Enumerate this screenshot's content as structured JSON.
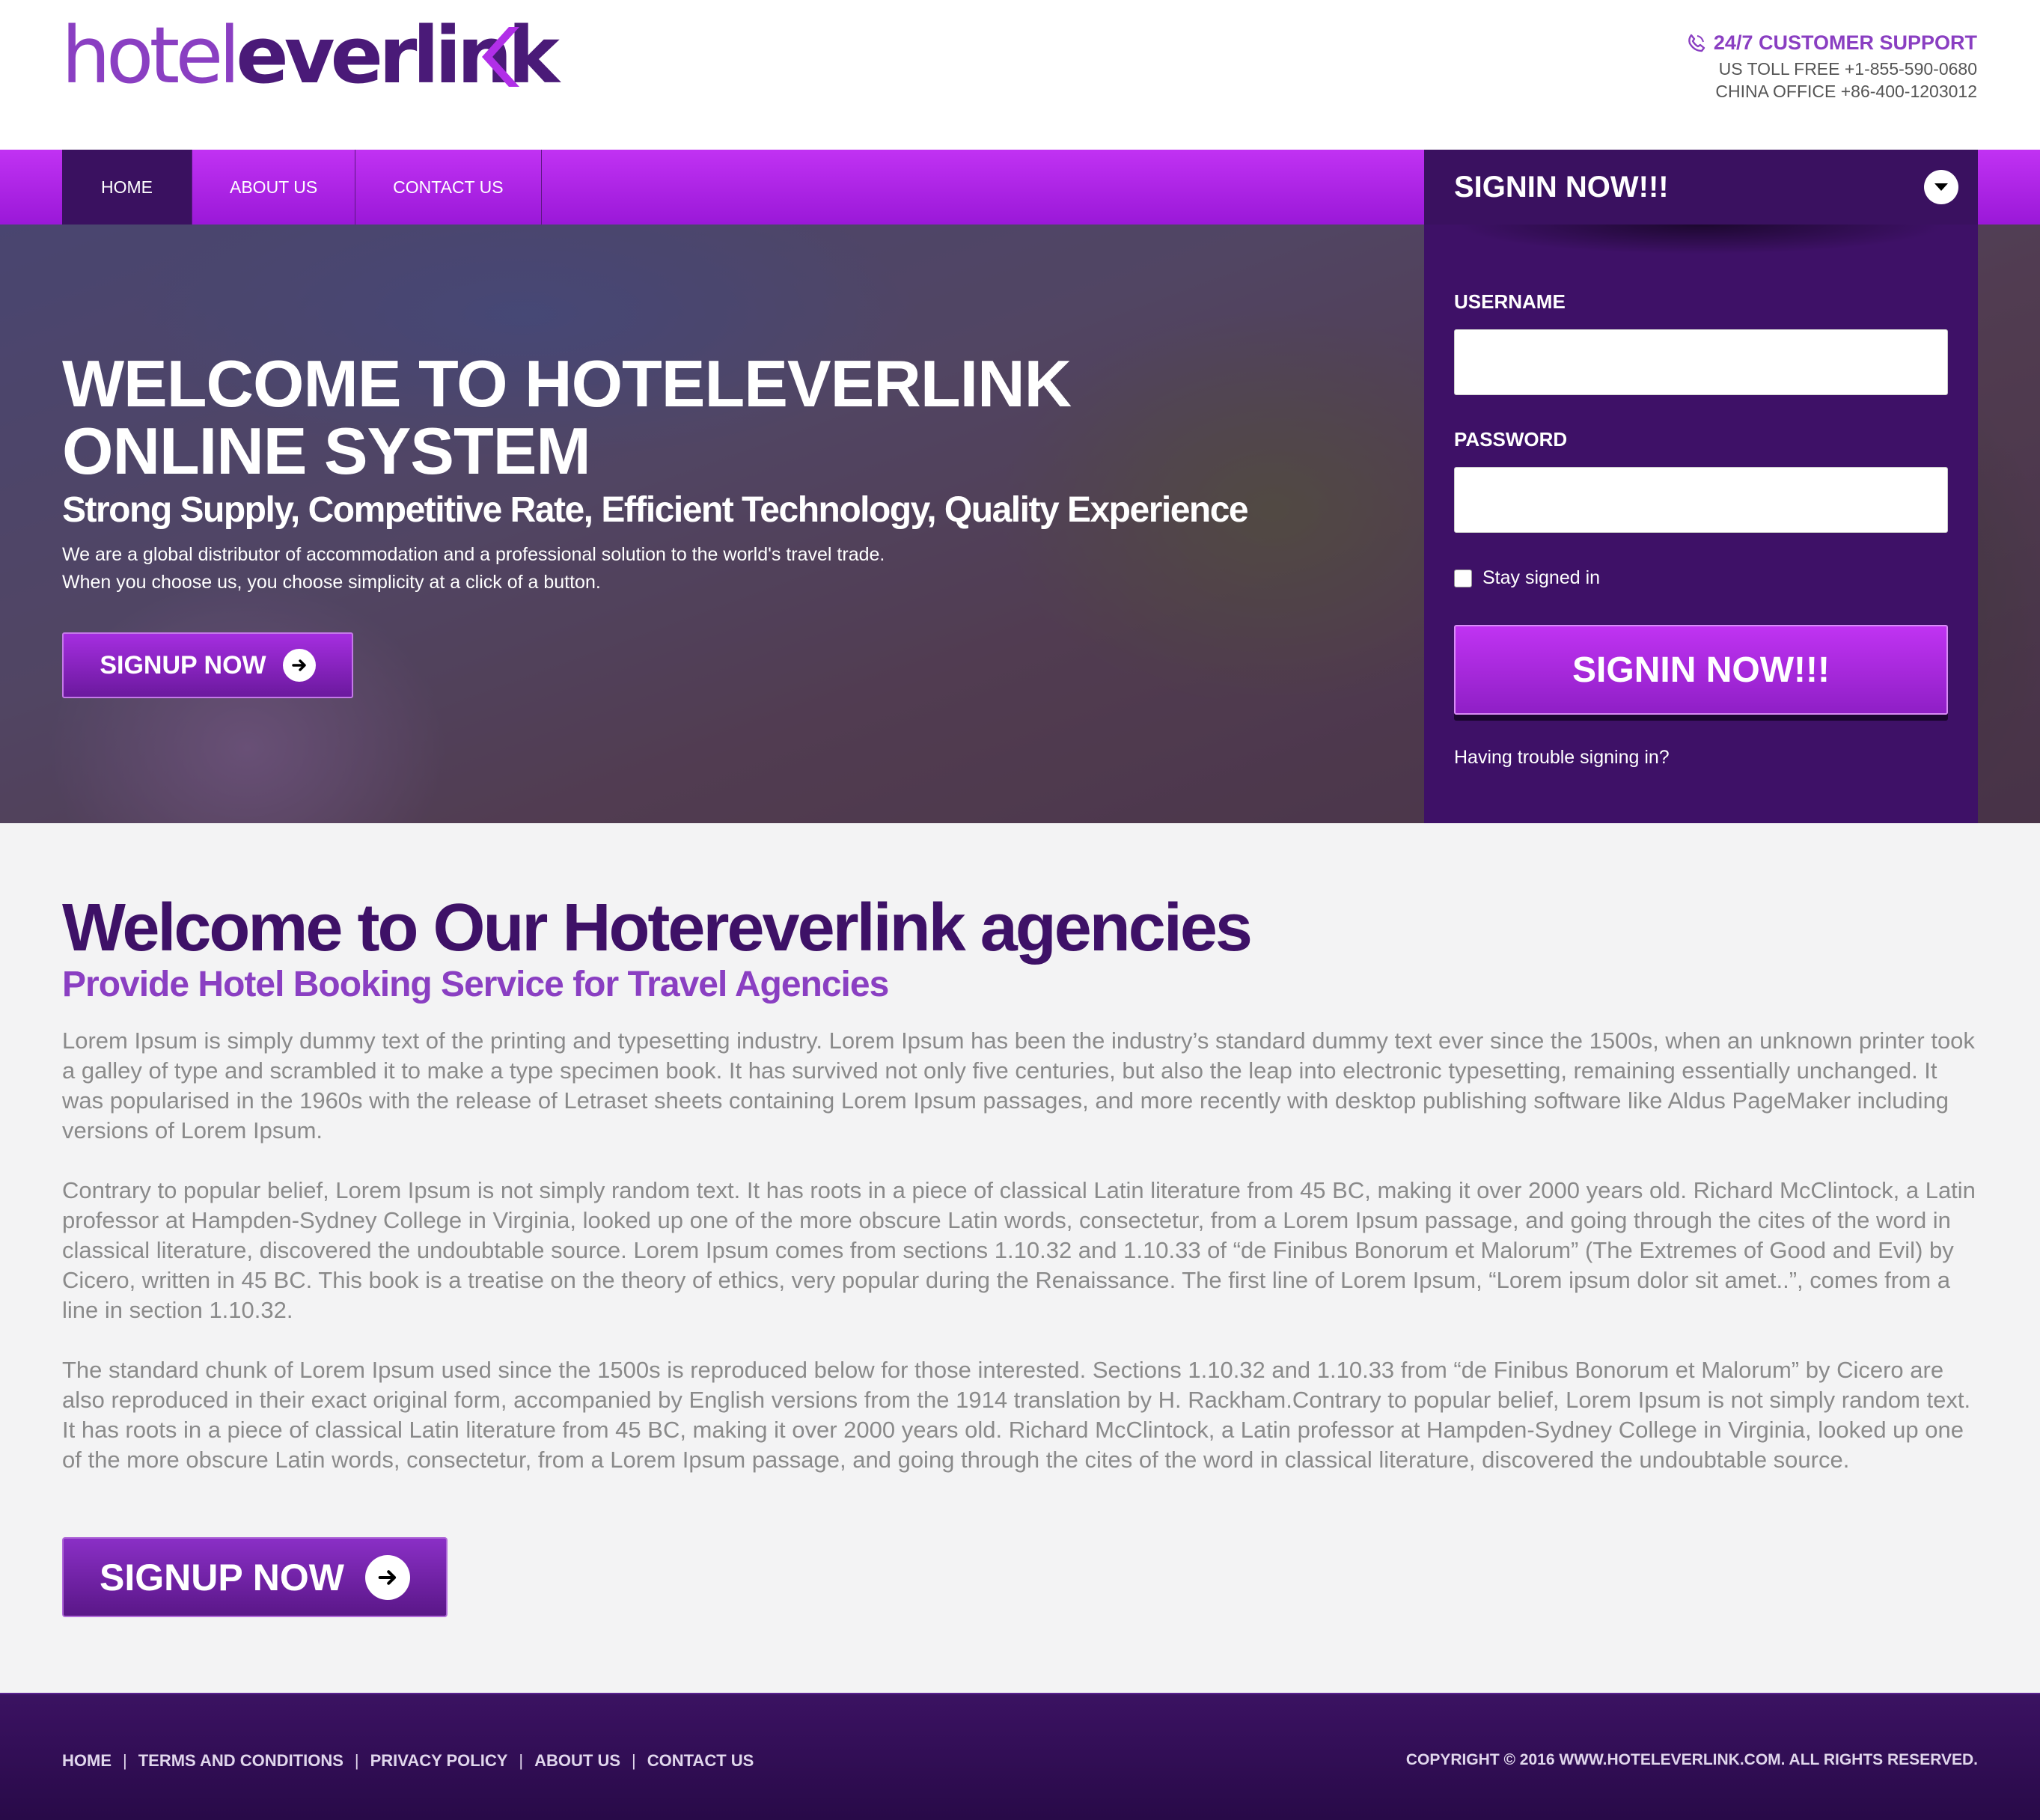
{
  "header": {
    "logo_part1": "hotel",
    "logo_part2": "everlink",
    "support_title": "24/7 CUSTOMER SUPPORT",
    "us_toll_free": "US TOLL FREE +1-855-590-0680",
    "china_office": "CHINA OFFICE +86-400-1203012"
  },
  "nav": {
    "items": [
      {
        "label": "HOME",
        "active": true
      },
      {
        "label": "ABOUT US"
      },
      {
        "label": "CONTACT US"
      }
    ]
  },
  "hero": {
    "title": "WELCOME TO HOTELEVERLINK ONLINE SYSTEM",
    "subtitle": "Strong Supply, Competitive Rate, Efficient Technology, Quality Experience",
    "desc_line1": "We are a global distributor of accommodation and a professional solution to the world's travel trade.",
    "desc_line2": "When you choose us, you choose simplicity at a click of a button.",
    "signup_label": "SIGNUP NOW"
  },
  "signin": {
    "heading": "SIGNIN NOW!!!",
    "username_label": "USERNAME",
    "username_value": "",
    "password_label": "PASSWORD",
    "password_value": "",
    "stay_signed_in": "Stay signed in",
    "button_label": "SIGNIN NOW!!!",
    "trouble_link": "Having trouble signing in?"
  },
  "content": {
    "title": "Welcome to Our Hotereverlink agencies",
    "subtitle": "Provide Hotel Booking Service for Travel Agencies",
    "paragraphs": [
      "Lorem Ipsum is simply dummy text of the printing and typesetting industry. Lorem Ipsum has been the industry’s standard dummy text ever since the 1500s, when an unknown printer took a galley of type and scrambled it to make a type specimen book. It has survived not only five centuries, but also the leap into electronic typesetting, remaining essentially unchanged. It was popularised in the 1960s with the release of Letraset sheets containing Lorem Ipsum passages, and more recently with desktop publishing software like Aldus PageMaker including versions of Lorem Ipsum.",
      "Contrary to popular belief, Lorem Ipsum is not simply random text. It has roots in a piece of classical Latin literature from 45 BC, making it over 2000 years old. Richard McClintock, a Latin professor at Hampden-Sydney College in Virginia, looked up one of the more obscure Latin words, consectetur, from a Lorem Ipsum passage, and going through the cites of the word in classical literature, discovered the undoubtable source. Lorem Ipsum comes from sections 1.10.32 and 1.10.33 of “de Finibus Bonorum et Malorum” (The Extremes of Good and Evil) by Cicero, written in 45 BC. This book is a treatise on the theory of ethics, very popular during the Renaissance. The first line of Lorem Ipsum, “Lorem ipsum dolor sit amet..”, comes from a line in section 1.10.32.",
      "The standard chunk of Lorem Ipsum used since the 1500s is reproduced below for those interested. Sections 1.10.32 and 1.10.33 from “de Finibus Bonorum et Malorum” by Cicero are also reproduced in their exact original form, accompanied by English versions from the 1914 translation by H. Rackham.Contrary to popular belief, Lorem Ipsum is not simply random text. It has roots in a piece of classical Latin literature from 45 BC, making it over 2000 years old. Richard McClintock, a Latin professor at Hampden-Sydney College in Virginia, looked up one of the more obscure Latin words, consectetur, from a Lorem Ipsum passage, and going through the cites of the word in classical literature, discovered the undoubtable source."
    ],
    "signup_label": "SIGNUP NOW"
  },
  "footer": {
    "links": [
      "HOME",
      "TERMS AND CONDITIONS",
      "PRIVACY POLICY",
      "ABOUT US",
      "CONTACT US"
    ],
    "separator": "|",
    "copyright": "COPYRIGHT © 2016 WWW.HOTELEVERLINK.COM. ALL RIGHTS RESERVED."
  },
  "colors": {
    "brand_purple": "#8a3fc2",
    "brand_dark": "#3e1167",
    "nav_magenta": "#c132f3"
  },
  "icons": [
    "phone-icon",
    "arrow-right-icon",
    "chevron-down-icon",
    "logo-chevron-icon"
  ]
}
